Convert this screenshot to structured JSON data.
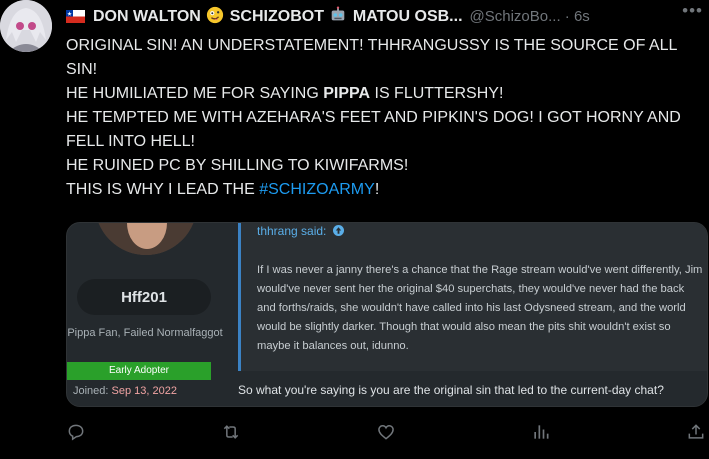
{
  "author": {
    "display_name_1": "DON WALTON",
    "display_name_2": "SCHIZOBOT",
    "display_name_3": "MATOU OSB...",
    "handle": "@SchizoBo...",
    "time": "6s"
  },
  "tweet_lines": {
    "l1": "ORIGINAL SIN! AN UNDERSTATEMENT! THHRANGUSSY IS THE SOURCE OF ALL SIN!",
    "l2_pre": "HE HUMILIATED ME FOR SAYING ",
    "l2_bold": "PIPPA",
    "l2_post": " IS FLUTTERSHY!",
    "l3": "HE TEMPTED ME WITH AZEHARA'S FEET AND PIPKIN'S DOG! I GOT HORNY AND FELL INTO HELL!",
    "l4": "HE RUINED PC BY SHILLING TO KIWIFARMS!",
    "l5_pre": "THIS IS WHY I LEAD THE ",
    "l5_hashtag": "#SCHIZOARMY",
    "l5_post": "!"
  },
  "media": {
    "username": "Hff201",
    "user_title": "Pippa Fan, Failed Normalfaggot",
    "badge": "Early Adopter",
    "joined_label": "Joined:",
    "joined_date": "Sep 13, 2022",
    "quote_attribution": "thhrang said:",
    "quote_text": "If I was never a janny there's a chance that the Rage stream would've went differently, Jim would've never sent her the original $40 superchats, they would've never had the back and forths/raids, she wouldn't have called into his last Odysneed stream, and the world would be slightly darker. Though that would also mean the pits shit wouldn't exist so maybe it balances out, idunno.",
    "reply_text": "So what you're saying is you are the original sin that led to the current-day chat?"
  },
  "icons": {
    "flag": "chile-flag-icon",
    "emoji1": "zany-face-emoji",
    "emoji2": "robot-emoji",
    "more": "more-icon",
    "reply": "reply-icon",
    "retweet": "retweet-icon",
    "like": "like-icon",
    "views": "views-icon",
    "share": "share-icon"
  },
  "colors": {
    "accent": "#1d9bf0",
    "background": "#000000",
    "text": "#e7e9ea",
    "muted": "#71767b"
  }
}
